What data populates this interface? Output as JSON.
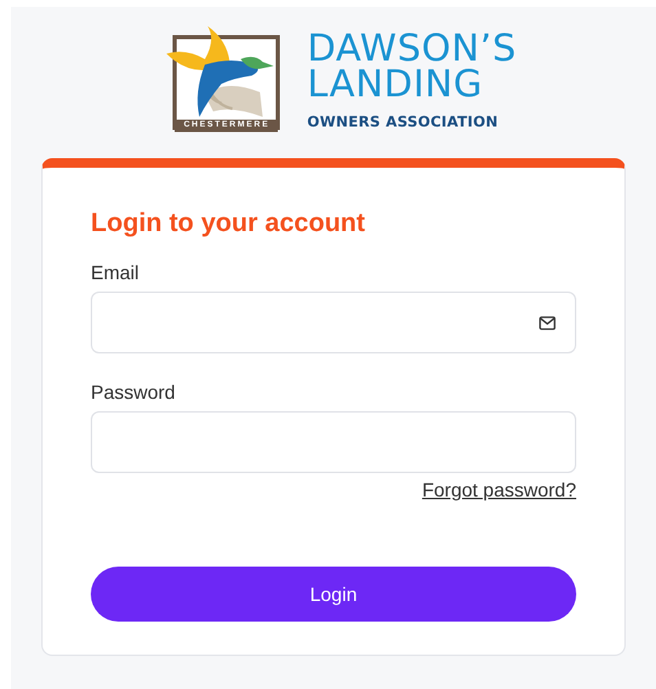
{
  "logo": {
    "badge_text": "CHESTERMERE",
    "title_lines": [
      "DAWSON’S",
      "LANDING"
    ],
    "subtitle": "OWNERS ASSOCIATION"
  },
  "form": {
    "heading": "Login to your account",
    "fields": [
      {
        "label": "Email",
        "kind": "email"
      },
      {
        "label": "Password",
        "kind": "password"
      }
    ],
    "forgot_link": "Forgot password?",
    "submit": "Login"
  }
}
